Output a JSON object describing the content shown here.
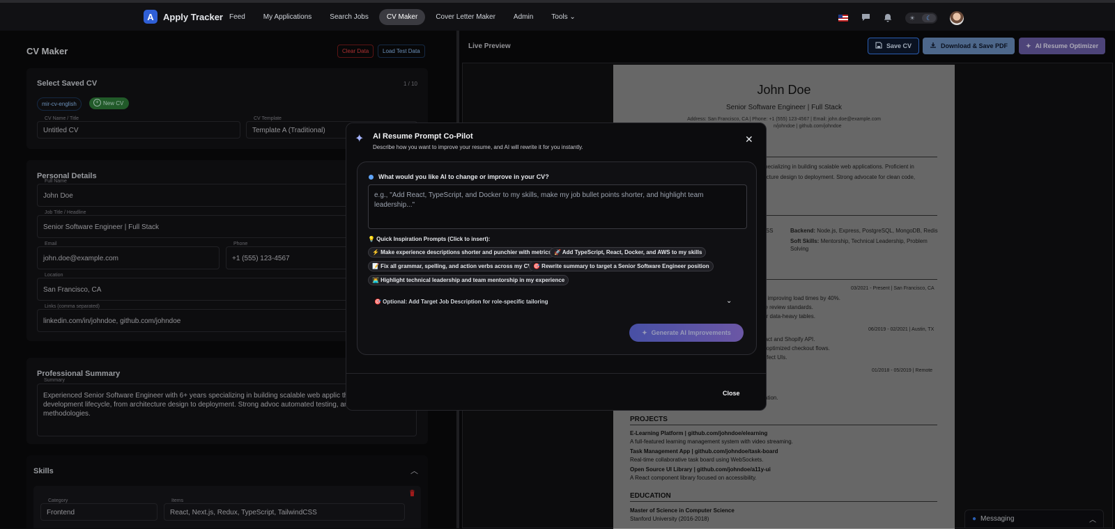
{
  "app": {
    "name": "Apply Tracker",
    "logo_letter": "A"
  },
  "nav": {
    "items": [
      "Feed",
      "My Applications",
      "Search Jobs",
      "CV Maker",
      "Cover Letter Maker",
      "Admin",
      "Tools"
    ],
    "active": "CV Maker"
  },
  "left": {
    "title": "CV Maker",
    "clear_label": "Clear Data",
    "load_label": "Load Test Data",
    "saved": {
      "heading": "Select Saved CV",
      "count": "1 / 10",
      "chip": "mir-cv-english",
      "new_label": "New CV",
      "name_label": "CV Name / Title",
      "name_value": "Untitled CV",
      "template_label": "CV Template",
      "template_value": "Template A (Traditional)"
    },
    "personal": {
      "heading": "Personal Details",
      "full_name_label": "Full Name",
      "full_name": "John Doe",
      "job_label": "Job Title / Headline",
      "job": "Senior Software Engineer | Full Stack",
      "email_label": "Email",
      "email": "john.doe@example.com",
      "phone_label": "Phone",
      "phone": "+1 (555) 123-4567",
      "location_label": "Location",
      "location": "San Francisco, CA",
      "links_label": "Links (comma separated)",
      "links": "linkedin.com/in/johndoe, github.com/johndoe"
    },
    "summary": {
      "heading": "Professional Summary",
      "label": "Summary",
      "text": "Experienced Senior Software Engineer with 6+ years specializing in building scalable web applic the entire software development lifecycle, from architecture design to deployment. Strong advoc automated testing, and agile methodologies."
    },
    "skills": {
      "heading": "Skills",
      "category_label": "Category",
      "category": "Frontend",
      "items_label": "Items",
      "items": "React, Next.js, Redux, TypeScript, TailwindCSS"
    }
  },
  "right": {
    "title": "Live Preview",
    "save_label": "Save CV",
    "pdf_label": "Download & Save PDF",
    "ai_label": "AI Resume Optimizer"
  },
  "resume": {
    "name": "John Doe",
    "headline": "Senior Software Engineer | Full Stack",
    "contact1": "Address: San Francisco, CA | Phone: +1 (555) 123-4567 | Email: john.doe@example.com",
    "contact2": "n/johndoe | github.com/johndoe",
    "summary1": "specializing in building scalable web applications. Proficient in",
    "summary2": "tecture design to deployment. Strong advocate for clean code,",
    "skills_left": "CSS",
    "backend": "Backend:",
    "backend_val": "Node.js, Express, PostgreSQL, MongoDB, Redis",
    "soft": "Soft Skills:",
    "soft_val": "Mentorship, Technical Leadership, Problem",
    "soft_val2": "Solving",
    "exp1_date": "03/2021 - Present | San Francisco, CA",
    "exp1_l1": "s, improving load times by 40%.",
    "exp1_l2": "de review standards.",
    "exp1_l3": "for data-heavy tables.",
    "exp2_date": "06/2019 - 02/2021 | Austin, TX",
    "exp2_l1": "eact and Shopify API.",
    "exp2_l2": "d optimized checkout flows.",
    "exp2_l3": "erfect UIs.",
    "exp3_date": "01/2018 - 05/2019 | Remote",
    "exp3_l1": "zation.",
    "projects": "PROJECTS",
    "p1_t": "E-Learning Platform | github.com/johndoe/elearning",
    "p1_d": "A full-featured learning management system with video streaming.",
    "p2_t": "Task Management App | github.com/johndoe/task-board",
    "p2_d": "Real-time collaborative task board using WebSockets.",
    "p3_t": "Open Source UI Library | github.com/johndoe/a11y-ui",
    "p3_d": "A React component library focused on accessibility.",
    "education": "EDUCATION",
    "e1_t": "Master of Science in Computer Science",
    "e1_d": "Stanford University (2016-2018)"
  },
  "messaging": {
    "label": "Messaging"
  },
  "modal": {
    "title": "AI Resume Prompt Co-Pilot",
    "description": "Describe how you want to improve your resume, and AI will rewrite it for you instantly.",
    "question": "What would you like AI to change or improve in your CV?",
    "placeholder": "e.g., \"Add React, TypeScript, and Docker to my skills, make my job bullet points shorter, and highlight team leadership...\"",
    "inspiration_label": "💡 Quick Inspiration Prompts (Click to insert):",
    "prompts": [
      "⚡ Make experience descriptions shorter and punchier with metrics",
      "🚀 Add TypeScript, React, Docker, and AWS to my skills",
      "📝 Fix all grammar, spelling, and action verbs across my CV",
      "🎯 Rewrite summary to target a Senior Software Engineer position",
      "👨‍💻 Highlight technical leadership and team mentorship in my experience"
    ],
    "optional_label": "🎯 Optional: Add Target Job Description for role-specific tailoring",
    "generate_label": "Generate AI Improvements",
    "close_label": "Close"
  },
  "colors": {
    "accent": "#2f5fd6",
    "modal_button": "#6f6ad8",
    "new_cv_green": "#2f7d3a",
    "clear_red": "#ef4444"
  },
  "icons": [
    "logo-icon",
    "chevron-down-icon",
    "flag-icon",
    "chat-icon",
    "bell-icon",
    "theme-toggle-icon",
    "avatar",
    "save-icon",
    "download-icon",
    "sparkle-icon",
    "close-icon",
    "trash-icon",
    "chevron-up-icon",
    "messaging-icon"
  ]
}
